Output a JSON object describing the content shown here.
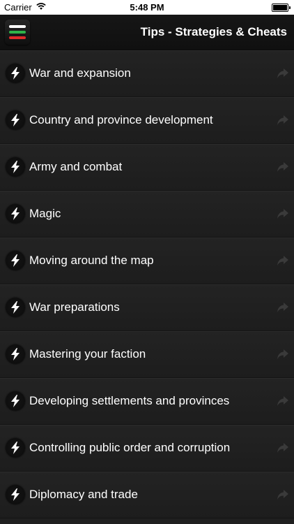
{
  "status_bar": {
    "carrier": "Carrier",
    "time": "5:48 PM"
  },
  "header": {
    "title": "Tips - Strategies & Cheats"
  },
  "items": [
    {
      "label": "War and expansion"
    },
    {
      "label": "Country and province development"
    },
    {
      "label": "Army and combat"
    },
    {
      "label": "Magic"
    },
    {
      "label": "Moving around the map"
    },
    {
      "label": "War preparations"
    },
    {
      "label": "Mastering your faction"
    },
    {
      "label": "Developing settlements and provinces"
    },
    {
      "label": "Controlling public order and corruption"
    },
    {
      "label": "Diplomacy and trade"
    }
  ],
  "icons": {
    "menu": "hamburger-menu-icon",
    "item": "lightning-bolt-icon",
    "row": "share-arrow-icon",
    "signal": "wifi-icon",
    "battery": "battery-icon"
  },
  "colors": {
    "menu_top": "#ffffff",
    "menu_middle": "#2fb34a",
    "menu_bottom": "#e02a2a"
  }
}
